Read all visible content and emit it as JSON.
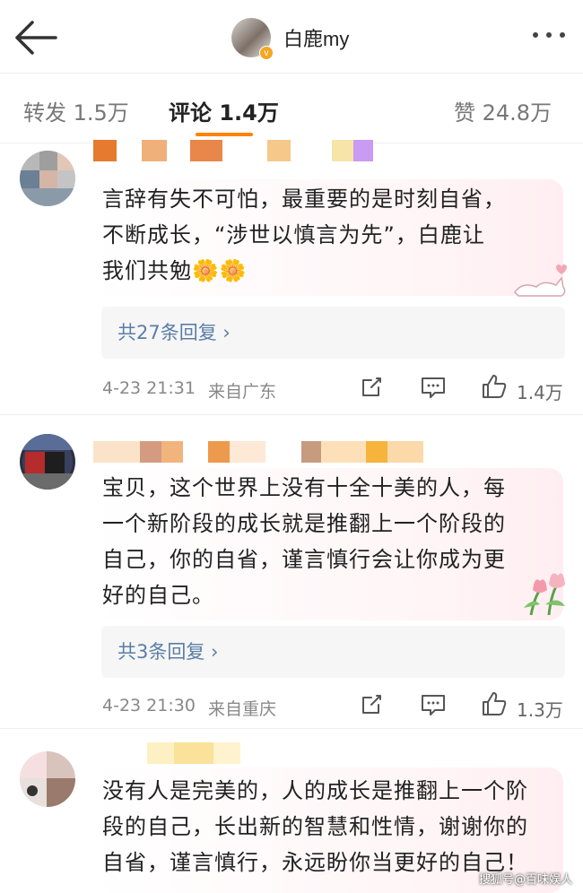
{
  "header": {
    "title": "白鹿my",
    "verified_badge": "v"
  },
  "tabs": [
    {
      "label": "转发 1.5万"
    },
    {
      "label": "评论 1.4万"
    },
    {
      "label": "赞 24.8万"
    }
  ],
  "comments": [
    {
      "text_lines": [
        "言辞有失不可怕，最重要的是时刻自省，",
        "不断成长，“涉世以慎言为先”，白鹿让",
        "我们共勉🌼🌼"
      ],
      "replies": "共27条回复 ›",
      "time": "4-23 21:31",
      "location": "来自广东",
      "likes": "1.4万"
    },
    {
      "text_lines": [
        "宝贝，这个世界上没有十全十美的人，每",
        "一个新阶段的成长就是推翻上一个阶段的",
        "自己，你的自省，谨言慎行会让你成为更",
        "好的自己。"
      ],
      "replies": "共3条回复 ›",
      "time": "4-23 21:30",
      "location": "来自重庆",
      "likes": "1.3万"
    },
    {
      "text_lines": [
        "没有人是完美的，人的成长是推翻上一个阶",
        "段的自己，长出新的智慧和性情，谢谢你的",
        "自省，谨言慎行，永远盼你当更好的自己！"
      ]
    }
  ],
  "watermark": "搜狐号@百味娱人",
  "colors": {
    "accent": "#ff8200",
    "link": "#5a7ea6",
    "meta": "#888888"
  }
}
